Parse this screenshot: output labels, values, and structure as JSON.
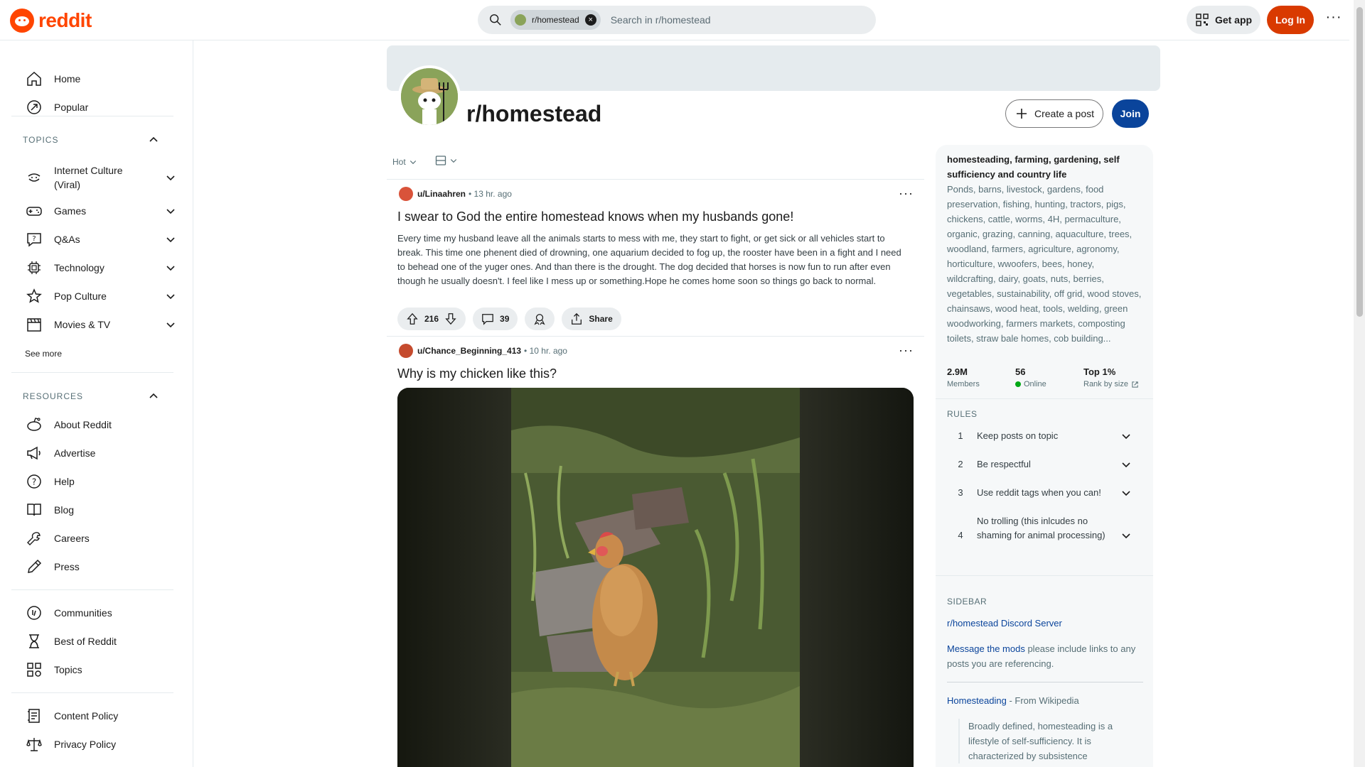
{
  "header": {
    "logo_text": "reddit",
    "search_chip": "r/homestead",
    "search_placeholder": "Search in r/homestead",
    "get_app": "Get app",
    "login": "Log In",
    "more": "···"
  },
  "sidebar": {
    "home": "Home",
    "popular": "Popular",
    "topics_title": "TOPICS",
    "topics": [
      {
        "label": "Internet Culture (Viral)",
        "icon": "smile-icon"
      },
      {
        "label": "Games",
        "icon": "gamepad-icon"
      },
      {
        "label": "Q&As",
        "icon": "question-bubble-icon"
      },
      {
        "label": "Technology",
        "icon": "chip-icon"
      },
      {
        "label": "Pop Culture",
        "icon": "star-icon"
      },
      {
        "label": "Movies & TV",
        "icon": "clapper-icon"
      }
    ],
    "see_more": "See more",
    "resources_title": "RESOURCES",
    "resources": [
      {
        "label": "About Reddit",
        "icon": "reddit-icon"
      },
      {
        "label": "Advertise",
        "icon": "megaphone-icon"
      },
      {
        "label": "Help",
        "icon": "help-icon"
      },
      {
        "label": "Blog",
        "icon": "book-icon"
      },
      {
        "label": "Careers",
        "icon": "wrench-icon"
      },
      {
        "label": "Press",
        "icon": "pen-icon"
      }
    ],
    "bottom1": [
      {
        "label": "Communities",
        "icon": "communities-icon"
      },
      {
        "label": "Best of Reddit",
        "icon": "hourglass-icon"
      },
      {
        "label": "Topics",
        "icon": "grid-icon"
      }
    ],
    "bottom2": [
      {
        "label": "Content Policy",
        "icon": "policy-icon"
      },
      {
        "label": "Privacy Policy",
        "icon": "scale-icon"
      }
    ]
  },
  "community": {
    "name": "r/homestead",
    "create_post": "Create a post",
    "join": "Join"
  },
  "feed": {
    "sort": "Hot",
    "posts": [
      {
        "author": "u/Linaahren",
        "time": "• 13 hr. ago",
        "title": "I swear to God the entire homestead knows when my husbands gone!",
        "body": "Every time my husband leave all the animals starts to mess with me, they start to fight, or get sick or all vehicles start to break. This time one phenent died of drowning, one aquarium decided to fog up, the rooster have been in a fight and I need to behead one of the yuger ones. And than there is the drought. The dog decided that horses is now fun to run after even though he usually doesn't. I feel like I mess up or something.Hope he comes home soon so things go back to normal.",
        "votes": "216",
        "comments": "39",
        "share": "Share"
      },
      {
        "author": "u/Chance_Beginning_413",
        "time": "• 10 hr. ago",
        "title": "Why is my chicken like this?"
      }
    ]
  },
  "about": {
    "title": "homesteading, farming, gardening, self sufficiency and country life",
    "description": "Ponds, barns, livestock, gardens, food preservation, fishing, hunting, tractors, pigs, chickens, cattle, worms, 4H, permaculture, organic, grazing, canning, aquaculture, trees, woodland, farmers, agriculture, agronomy, horticulture, wwoofers, bees, honey, wildcrafting, dairy, goats, nuts, berries, vegetables, sustainability, off grid, wood stoves, chainsaws, wood heat, tools, welding, green woodworking, farmers markets, composting toilets, straw bale homes, cob building...",
    "members_value": "2.9M",
    "members_label": "Members",
    "online_value": "56",
    "online_label": "Online",
    "rank_value": "Top 1%",
    "rank_label": "Rank by size"
  },
  "rules": {
    "title": "RULES",
    "items": [
      {
        "num": "1",
        "text": "Keep posts on topic"
      },
      {
        "num": "2",
        "text": "Be respectful"
      },
      {
        "num": "3",
        "text": "Use reddit tags when you can!"
      },
      {
        "num": "4",
        "text": "No trolling (this inlcudes no shaming for animal processing)"
      }
    ]
  },
  "sidebar_widget": {
    "title": "SIDEBAR",
    "discord_link": "r/homestead Discord Server",
    "mods_link": "Message the mods",
    "mods_text": " please include links to any posts you are referencing.",
    "wiki_link": "Homesteading",
    "wiki_suffix": " - From Wikipedia",
    "wiki_quote": "Broadly defined, homesteading is a lifestyle of self-sufficiency. It is characterized by subsistence"
  },
  "colors": {
    "brand": "#ff4500",
    "login_bg": "#d93a00",
    "join_bg": "#0a449b",
    "link": "#0a449b"
  }
}
